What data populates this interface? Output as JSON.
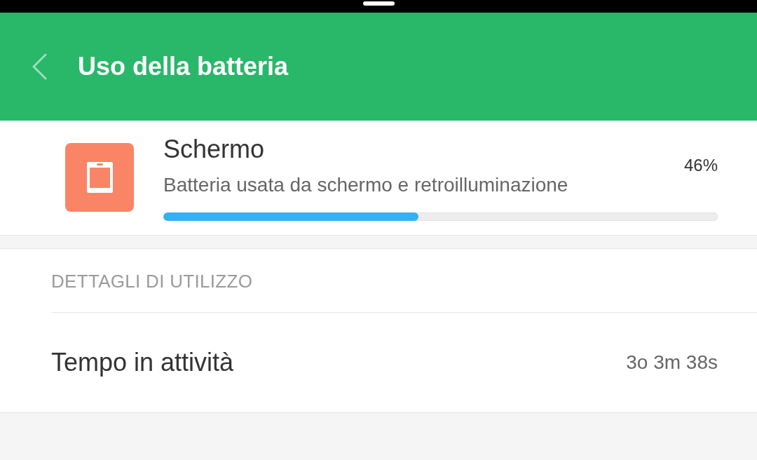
{
  "header": {
    "title": "Uso della batteria"
  },
  "app": {
    "name": "Schermo",
    "description": "Batteria usata da schermo e retroilluminazione",
    "percentage": "46%",
    "level": 0.46
  },
  "details": {
    "heading": "DETTAGLI DI UTILIZZO",
    "rows": [
      {
        "label": "Tempo in attività",
        "value": "3o 3m 38s"
      }
    ]
  }
}
